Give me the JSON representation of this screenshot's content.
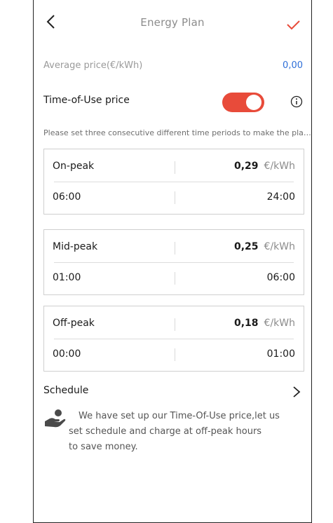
{
  "header": {
    "title": "Energy Plan",
    "back_icon": "chevron-left-icon",
    "confirm_icon": "checkmark-icon"
  },
  "average": {
    "label": "Average price(€/kWh)",
    "value": "0,00"
  },
  "tou": {
    "label": "Time-of-Use price",
    "enabled": true,
    "info_icon": "info-icon"
  },
  "hint": "Please set three consecutive different time periods to make the plan effective.",
  "periods": [
    {
      "name": "On-peak",
      "price": "0,29",
      "unit": "€/kWh",
      "start": "06:00",
      "end": "24:00"
    },
    {
      "name": "Mid-peak",
      "price": "0,25",
      "unit": "€/kWh",
      "start": "01:00",
      "end": "06:00"
    },
    {
      "name": "Off-peak",
      "price": "0,18",
      "unit": "€/kWh",
      "start": "00:00",
      "end": "01:00"
    }
  ],
  "schedule": {
    "label": "Schedule",
    "tip_line1": "We have set up our Time-Of-Use price,let us",
    "tip_line2": "set schedule and charge at off-peak hours",
    "tip_line3": "to save money."
  },
  "colors": {
    "accent_red": "#e84b3a",
    "link_blue": "#2f6fd8"
  }
}
